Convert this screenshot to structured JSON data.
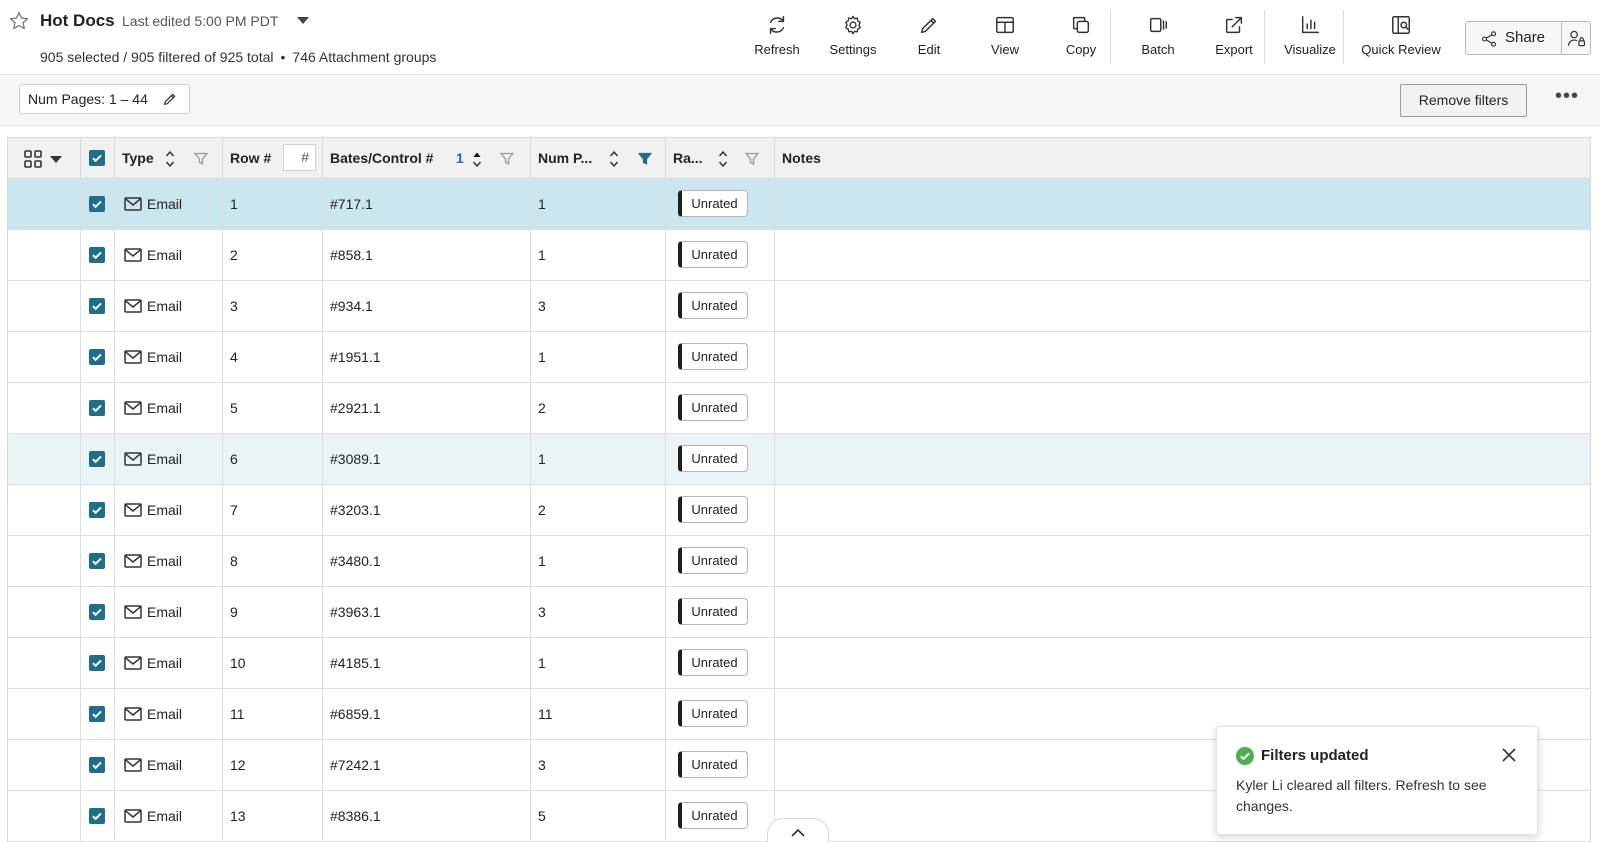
{
  "header": {
    "title": "Hot Docs",
    "last_edited": "Last edited 5:00 PM PDT",
    "selection_summary": "905 selected / 905 filtered of 925 total",
    "separator": "•",
    "groups_summary": "746 Attachment groups",
    "star_icon": "star-outline-icon"
  },
  "toolbar": {
    "refresh": "Refresh",
    "settings": "Settings",
    "edit": "Edit",
    "view": "View",
    "copy": "Copy",
    "batch": "Batch",
    "export": "Export",
    "visualize": "Visualize",
    "quick_review": "Quick Review",
    "share": "Share"
  },
  "filters": {
    "chip_key": "Num Pages:",
    "chip_value": "1 – 44",
    "remove_label": "Remove filters",
    "more_label": "•••"
  },
  "table": {
    "columns": {
      "type": "Type",
      "row": "Row #",
      "row_search_placeholder": "#",
      "bates": "Bates/Control #",
      "bates_sort_order": "1",
      "num_pages": "Num P...",
      "rating": "Ra...",
      "notes": "Notes"
    },
    "rows": [
      {
        "type": "Email",
        "row": "1",
        "bates": "#717.1",
        "pages": "1",
        "rating": "Unrated",
        "notes": ""
      },
      {
        "type": "Email",
        "row": "2",
        "bates": "#858.1",
        "pages": "1",
        "rating": "Unrated",
        "notes": ""
      },
      {
        "type": "Email",
        "row": "3",
        "bates": "#934.1",
        "pages": "3",
        "rating": "Unrated",
        "notes": ""
      },
      {
        "type": "Email",
        "row": "4",
        "bates": "#1951.1",
        "pages": "1",
        "rating": "Unrated",
        "notes": ""
      },
      {
        "type": "Email",
        "row": "5",
        "bates": "#2921.1",
        "pages": "2",
        "rating": "Unrated",
        "notes": ""
      },
      {
        "type": "Email",
        "row": "6",
        "bates": "#3089.1",
        "pages": "1",
        "rating": "Unrated",
        "notes": ""
      },
      {
        "type": "Email",
        "row": "7",
        "bates": "#3203.1",
        "pages": "2",
        "rating": "Unrated",
        "notes": ""
      },
      {
        "type": "Email",
        "row": "8",
        "bates": "#3480.1",
        "pages": "1",
        "rating": "Unrated",
        "notes": ""
      },
      {
        "type": "Email",
        "row": "9",
        "bates": "#3963.1",
        "pages": "3",
        "rating": "Unrated",
        "notes": ""
      },
      {
        "type": "Email",
        "row": "10",
        "bates": "#4185.1",
        "pages": "1",
        "rating": "Unrated",
        "notes": ""
      },
      {
        "type": "Email",
        "row": "11",
        "bates": "#6859.1",
        "pages": "11",
        "rating": "Unrated",
        "notes": ""
      },
      {
        "type": "Email",
        "row": "12",
        "bates": "#7242.1",
        "pages": "3",
        "rating": "Unrated",
        "notes": ""
      },
      {
        "type": "Email",
        "row": "13",
        "bates": "#8386.1",
        "pages": "5",
        "rating": "Unrated",
        "notes": ""
      }
    ],
    "active_row": "1",
    "hover_row": "6"
  },
  "toast": {
    "title": "Filters updated",
    "message": "Kyler Li cleared all filters. Refresh to see changes."
  },
  "colors": {
    "accent": "#1f6f8b",
    "active_row_bg": "#cbe6ee",
    "hover_row_bg": "#eaf4f7",
    "success": "#4caf50",
    "rating_bar": "#1e1e1e"
  }
}
